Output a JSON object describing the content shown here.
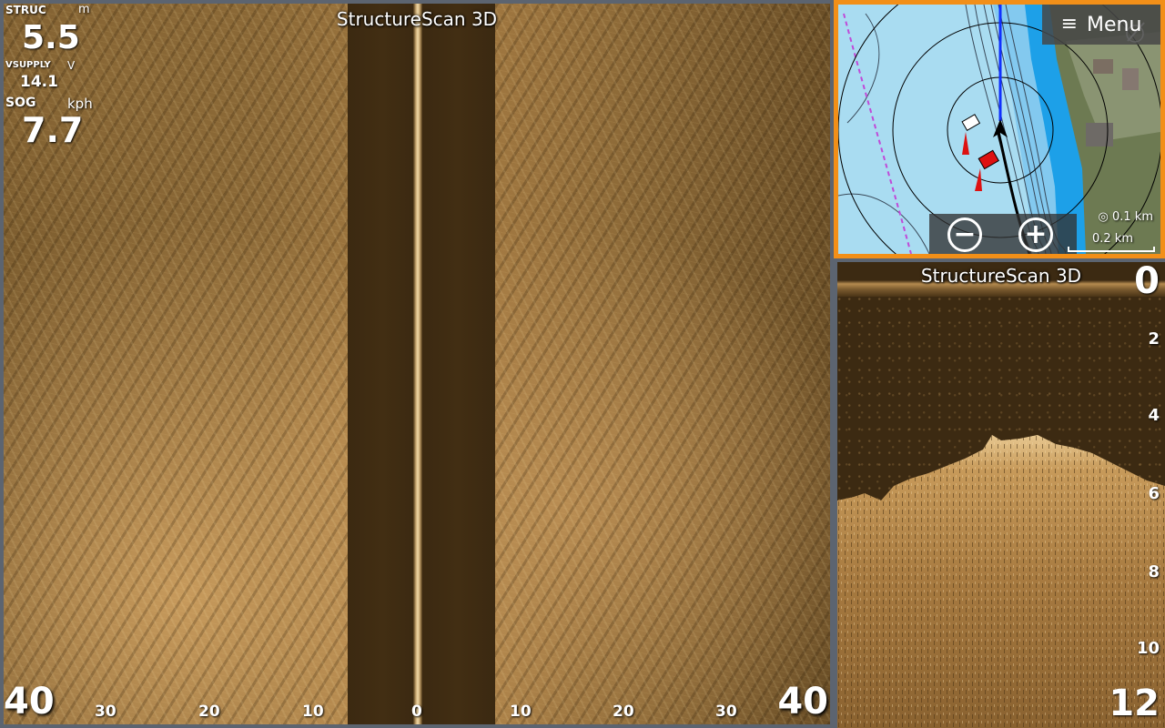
{
  "sidescan": {
    "title": "StructureScan 3D",
    "data_boxes": {
      "struc": {
        "label": "STRUC",
        "unit": "m",
        "value": "5.5"
      },
      "vsupply": {
        "label": "VSUPPLY",
        "unit": "V",
        "value": "14.1"
      },
      "sog": {
        "label": "SOG",
        "unit": "kph",
        "value": "7.7"
      }
    },
    "range_left": "40",
    "range_right": "40",
    "ticks_left": [
      "30",
      "20",
      "10"
    ],
    "tick_center": "0",
    "ticks_right": [
      "10",
      "20",
      "30"
    ]
  },
  "map": {
    "menu_label": "Menu",
    "menu_icon": "hamburger-icon",
    "compass_icon": "north-arrow-icon",
    "zoom_out_icon": "minus-icon",
    "zoom_in_icon": "plus-icon",
    "range_ring_label": "◎ 0.1 km",
    "scale_bar_label": "0.2 km",
    "border_color": "#f28f18",
    "water_color": "#a9dcf1",
    "heading_line_color": "#1030ff"
  },
  "downscan": {
    "title": "StructureScan 3D",
    "depth_top": "0",
    "depth_bottom": "12",
    "depth_ticks": [
      "2",
      "4",
      "6",
      "8",
      "10"
    ]
  }
}
